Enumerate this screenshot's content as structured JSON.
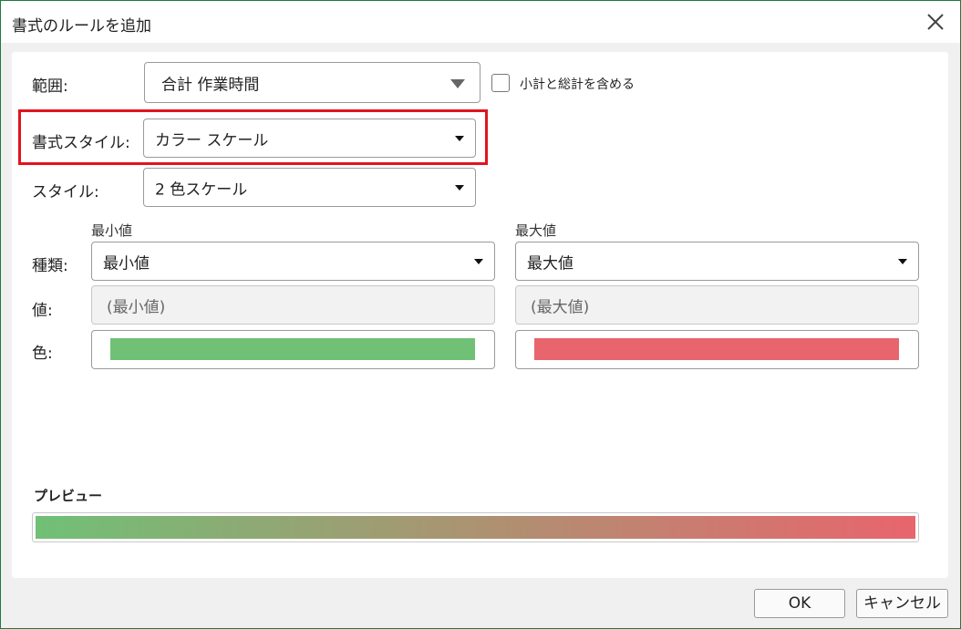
{
  "dialog": {
    "title": "書式のルールを追加",
    "close_icon": "close-icon"
  },
  "range": {
    "label": "範囲:",
    "value": "合計 作業時間",
    "include_subtotals_label": "小計と総計を含める",
    "include_subtotals_checked": false
  },
  "format_style": {
    "label": "書式スタイル:",
    "value": "カラー スケール",
    "highlight_color": "#e0141e"
  },
  "style": {
    "label": "スタイル:",
    "value": "2 色スケール"
  },
  "rows": {
    "type_label": "種類:",
    "value_label": "値:",
    "color_label": "色:"
  },
  "min": {
    "header": "最小値",
    "type_value": "最小値",
    "value_placeholder": "(最小値)",
    "color": "#70c076"
  },
  "max": {
    "header": "最大値",
    "type_value": "最大値",
    "value_placeholder": "(最大値)",
    "color": "#e8656d"
  },
  "preview": {
    "label": "プレビュー"
  },
  "buttons": {
    "ok": "OK",
    "cancel": "キャンセル"
  }
}
